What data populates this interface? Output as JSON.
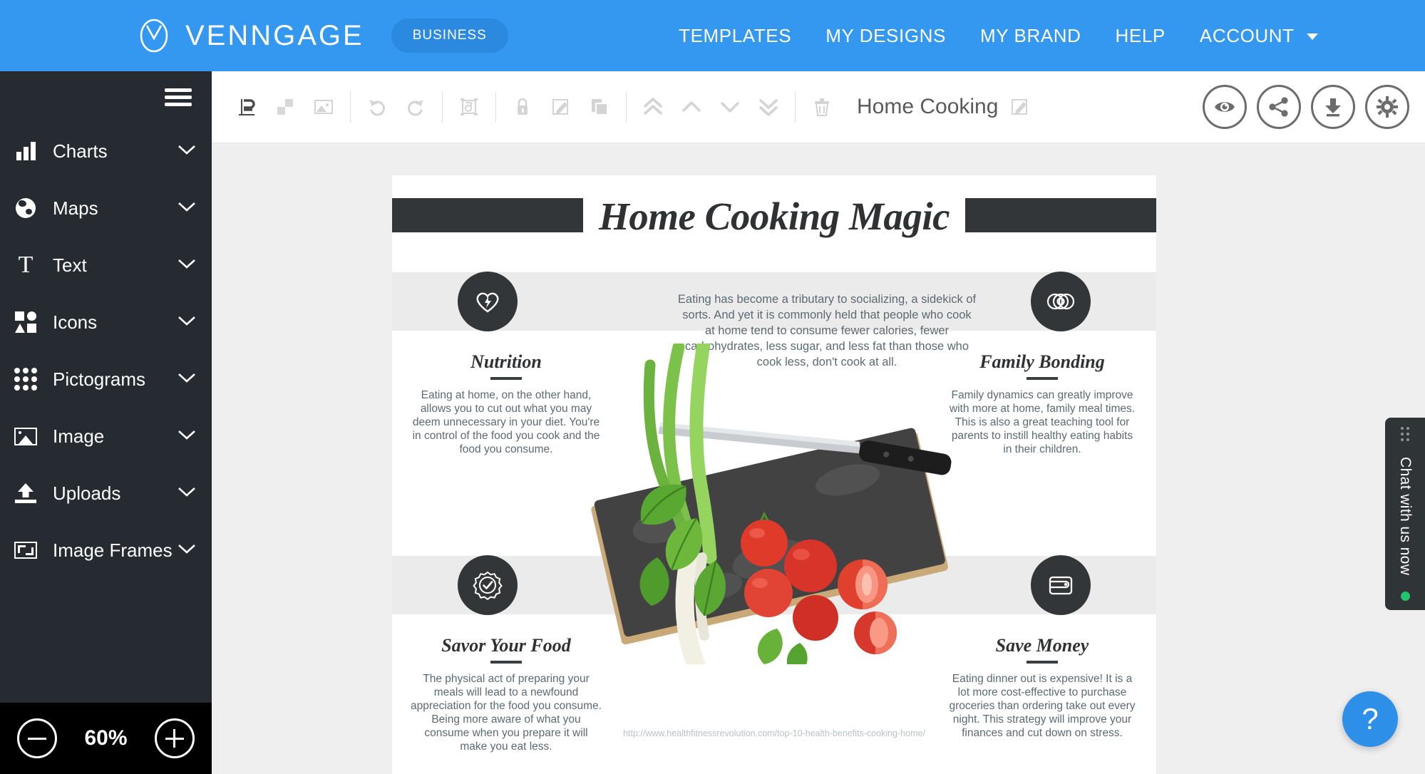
{
  "topnav": {
    "brand_name": "VENNGAGE",
    "plan_badge": "BUSINESS",
    "links": [
      {
        "label": "TEMPLATES"
      },
      {
        "label": "MY DESIGNS"
      },
      {
        "label": "MY BRAND"
      },
      {
        "label": "HELP"
      },
      {
        "label": "ACCOUNT"
      }
    ],
    "bg_color": "#3498f0"
  },
  "sidebar": {
    "bg_color": "#262b31",
    "items": [
      {
        "label": "Charts",
        "icon": "bar-chart-icon"
      },
      {
        "label": "Maps",
        "icon": "globe-icon"
      },
      {
        "label": "Text",
        "icon": "text-icon"
      },
      {
        "label": "Icons",
        "icon": "shapes-icon"
      },
      {
        "label": "Pictograms",
        "icon": "dot-grid-icon"
      },
      {
        "label": "Image",
        "icon": "picture-icon"
      },
      {
        "label": "Uploads",
        "icon": "upload-icon"
      },
      {
        "label": "Image Frames",
        "icon": "frame-icon"
      }
    ]
  },
  "zoombar": {
    "zoom_out_label": "−",
    "zoom_value": "60%",
    "zoom_in_label": "+"
  },
  "toolbar": {
    "doc_title": "Home Cooking",
    "tools": [
      {
        "name": "align-icon"
      },
      {
        "name": "background-icon"
      },
      {
        "name": "image-icon"
      },
      {
        "name": "undo-icon"
      },
      {
        "name": "redo-icon"
      },
      {
        "name": "crop-icon"
      },
      {
        "name": "lock-icon"
      },
      {
        "name": "edit-icon"
      },
      {
        "name": "duplicate-icon"
      },
      {
        "name": "bring-to-front-icon"
      },
      {
        "name": "bring-forward-icon"
      },
      {
        "name": "send-backward-icon"
      },
      {
        "name": "send-to-back-icon"
      },
      {
        "name": "delete-icon"
      }
    ],
    "actions": [
      {
        "name": "preview-button",
        "icon": "eye-icon"
      },
      {
        "name": "share-button",
        "icon": "share-icon"
      },
      {
        "name": "download-button",
        "icon": "download-icon"
      },
      {
        "name": "settings-button",
        "icon": "gear-icon"
      }
    ]
  },
  "canvas": {
    "headline": "Home Cooking Magic",
    "intro": "Eating has become a tributary to socializing, a sidekick of sorts. And yet it is commonly held that people who cook at home tend to consume fewer calories, fewer carbohydrates, less sugar, and less fat than those who cook less, don't cook at all.",
    "source_url": "http://www.healthfitnessrevolution.com/top-10-health-benefits-cooking-home/",
    "sections": [
      {
        "title": "Nutrition",
        "icon": "heart-bolt-icon",
        "body": "Eating at home, on the other hand, allows you to cut out what you may deem unnecessary in your diet. You're in control of the food you cook and the food you consume."
      },
      {
        "title": "Family Bonding",
        "icon": "linked-rings-icon",
        "body": "Family dynamics can greatly improve with more at home, family meal times. This is also a great teaching tool for parents to instill healthy eating habits in their children."
      },
      {
        "title": "Savor Your Food",
        "icon": "check-seal-icon",
        "body": "The physical act of preparing your meals will lead to a newfound appreciation for the food you consume. Being more aware of what you consume when you prepare it will make you eat less."
      },
      {
        "title": "Save Money",
        "icon": "wallet-icon",
        "body": "Eating dinner out is expensive! It is a lot more cost-effective to purchase groceries than ordering take out every night. This strategy will improve your finances and cut down on stress."
      }
    ],
    "dark_color": "#333638",
    "band_color": "#ebebeb"
  },
  "chat_widget": {
    "label": "Chat with us now",
    "status_color": "#21c56b"
  },
  "help_fab": {
    "label": "?"
  }
}
